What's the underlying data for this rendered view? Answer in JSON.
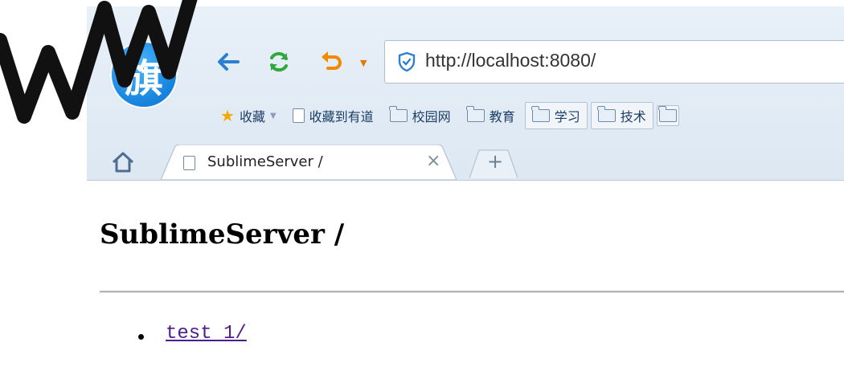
{
  "browser": {
    "logo_text": "旗",
    "url": "http://localhost:8080/",
    "bookmarks": [
      {
        "label": "收藏",
        "icon": "star-icon"
      },
      {
        "label": "收藏到有道",
        "icon": "page-icon"
      },
      {
        "label": "校园网",
        "icon": "folder-icon"
      },
      {
        "label": "教育",
        "icon": "folder-icon"
      },
      {
        "label": "学习",
        "icon": "folder-icon"
      },
      {
        "label": "技术",
        "icon": "folder-icon"
      }
    ],
    "tab": {
      "title": "SublimeServer /",
      "close": "×"
    },
    "new_tab": "+",
    "colors": {
      "accent_blue": "#2f7fd1",
      "refresh_green": "#2ea83a",
      "undo_orange": "#f08a00"
    }
  },
  "page": {
    "heading": "SublimeServer /",
    "items": [
      "test 1/"
    ]
  }
}
